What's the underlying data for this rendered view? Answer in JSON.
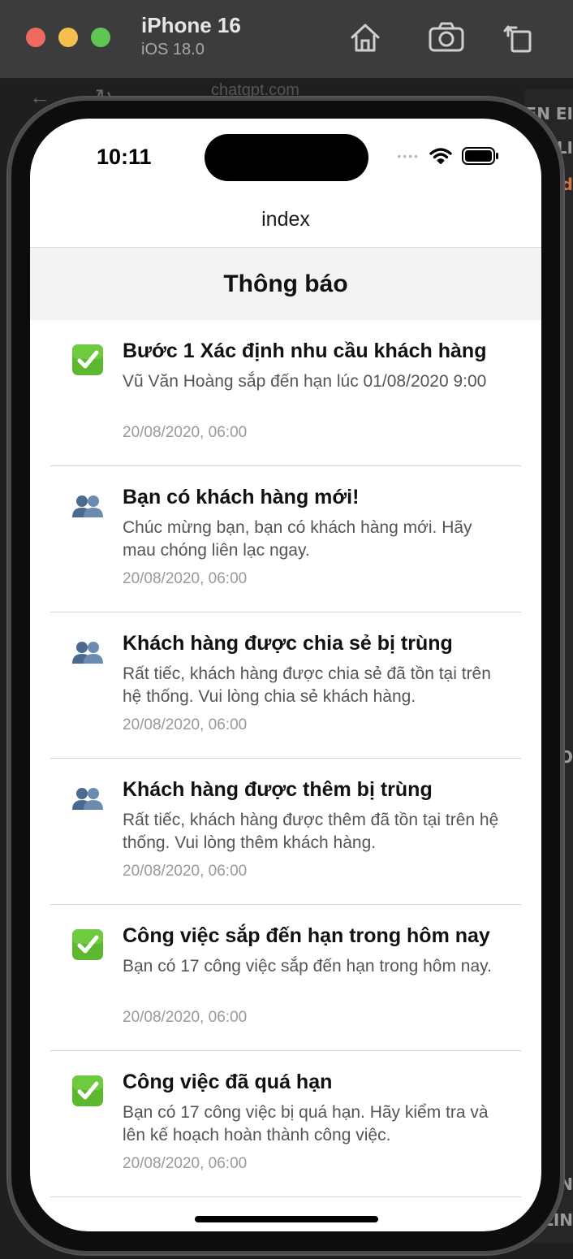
{
  "simulator": {
    "device_name": "iPhone 16",
    "os_version": "iOS 18.0"
  },
  "background": {
    "url_fragment": "chatgpt.com",
    "right_labels": [
      "PEN EI",
      "TLI",
      "d",
      "O",
      "N",
      "ELIN"
    ]
  },
  "status_bar": {
    "time": "10:11"
  },
  "nav": {
    "title": "index"
  },
  "section": {
    "title": "Thông báo"
  },
  "notifications": [
    {
      "icon": "check-mark-icon",
      "title": "Bước 1 Xác định nhu cầu khách hàng",
      "body": "Vũ Văn Hoàng sắp đến hạn lúc 01/08/2020 9:00",
      "time": "20/08/2020, 06:00"
    },
    {
      "icon": "people-icon",
      "title": "Bạn có khách hàng mới!",
      "body": "Chúc mừng bạn, bạn có khách hàng mới. Hãy mau chóng liên lạc ngay.",
      "time": "20/08/2020, 06:00"
    },
    {
      "icon": "people-icon",
      "title": "Khách hàng được chia sẻ bị trùng",
      "body": "Rất tiếc, khách hàng được chia sẻ đã tồn tại trên hệ thống. Vui lòng chia sẻ khách hàng.",
      "time": "20/08/2020, 06:00"
    },
    {
      "icon": "people-icon",
      "title": "Khách hàng được thêm bị trùng",
      "body": "Rất tiếc, khách hàng được thêm đã tồn tại trên hệ thống. Vui lòng thêm khách hàng.",
      "time": "20/08/2020, 06:00"
    },
    {
      "icon": "check-mark-icon",
      "title": "Công việc sắp đến hạn trong hôm nay",
      "body": "Bạn có 17 công việc sắp đến hạn trong hôm nay.",
      "time": "20/08/2020, 06:00"
    },
    {
      "icon": "check-mark-icon",
      "title": "Công việc đã quá hạn",
      "body": "Bạn có 17 công việc bị quá hạn. Hãy kiểm tra và lên kế hoạch hoàn thành công việc.",
      "time": "20/08/2020, 06:00"
    }
  ]
}
